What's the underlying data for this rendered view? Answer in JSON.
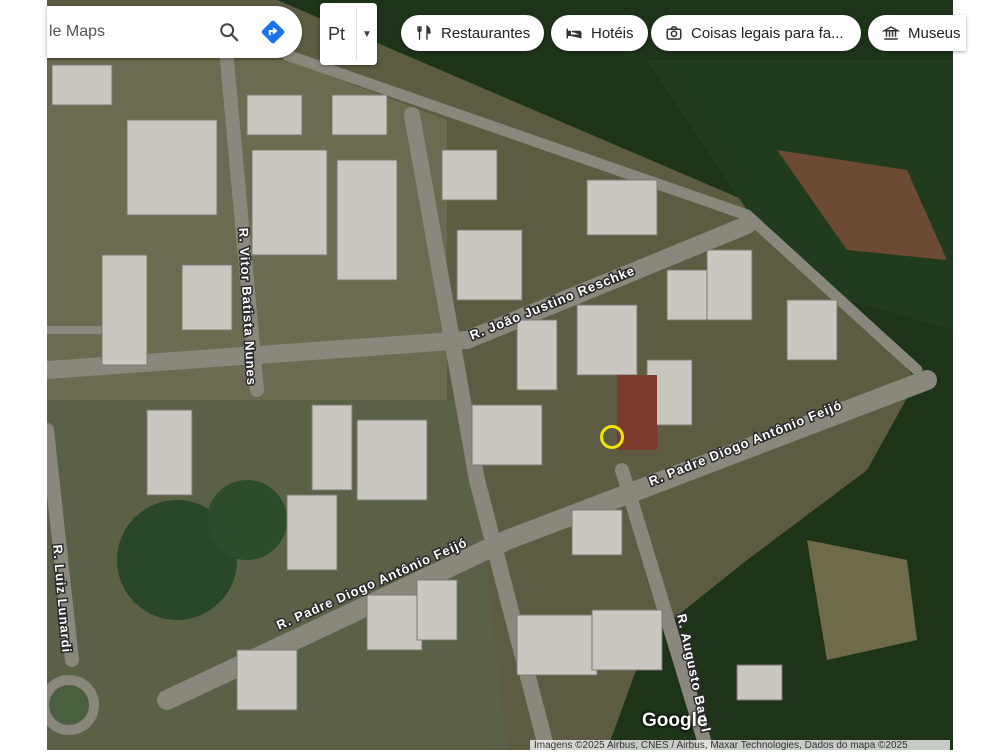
{
  "search": {
    "text": "le Maps"
  },
  "layer_toggle": {
    "label": "Pt"
  },
  "chips": [
    {
      "label": "Restaurantes",
      "icon": "fork-knife-icon"
    },
    {
      "label": "Hotéis",
      "icon": "bed-icon"
    },
    {
      "label": "Coisas legais para fa...",
      "icon": "camera-icon"
    },
    {
      "label": "Museus",
      "icon": "museum-icon"
    }
  ],
  "streets": {
    "vitor": "R. Vitor Batista Nunes",
    "joao": "R. João Justino Reschke",
    "padre_right": "R. Padre Diogo Antônio Feijó",
    "padre_left": "R. Padre Diogo Antônio Feijó",
    "luiz": "R. Luiz Lunardi",
    "augusto": "R. Augusto Barel"
  },
  "logo": "Google",
  "attribution": "Imagens ©2025 Airbus, CNES / Airbus, Maxar Technologies, Dados do mapa ©2025",
  "colors": {
    "marker": "#f2e600",
    "road": "#8c8a82",
    "vegetation": "#1f3a1c",
    "field": "#6f6a4f"
  }
}
